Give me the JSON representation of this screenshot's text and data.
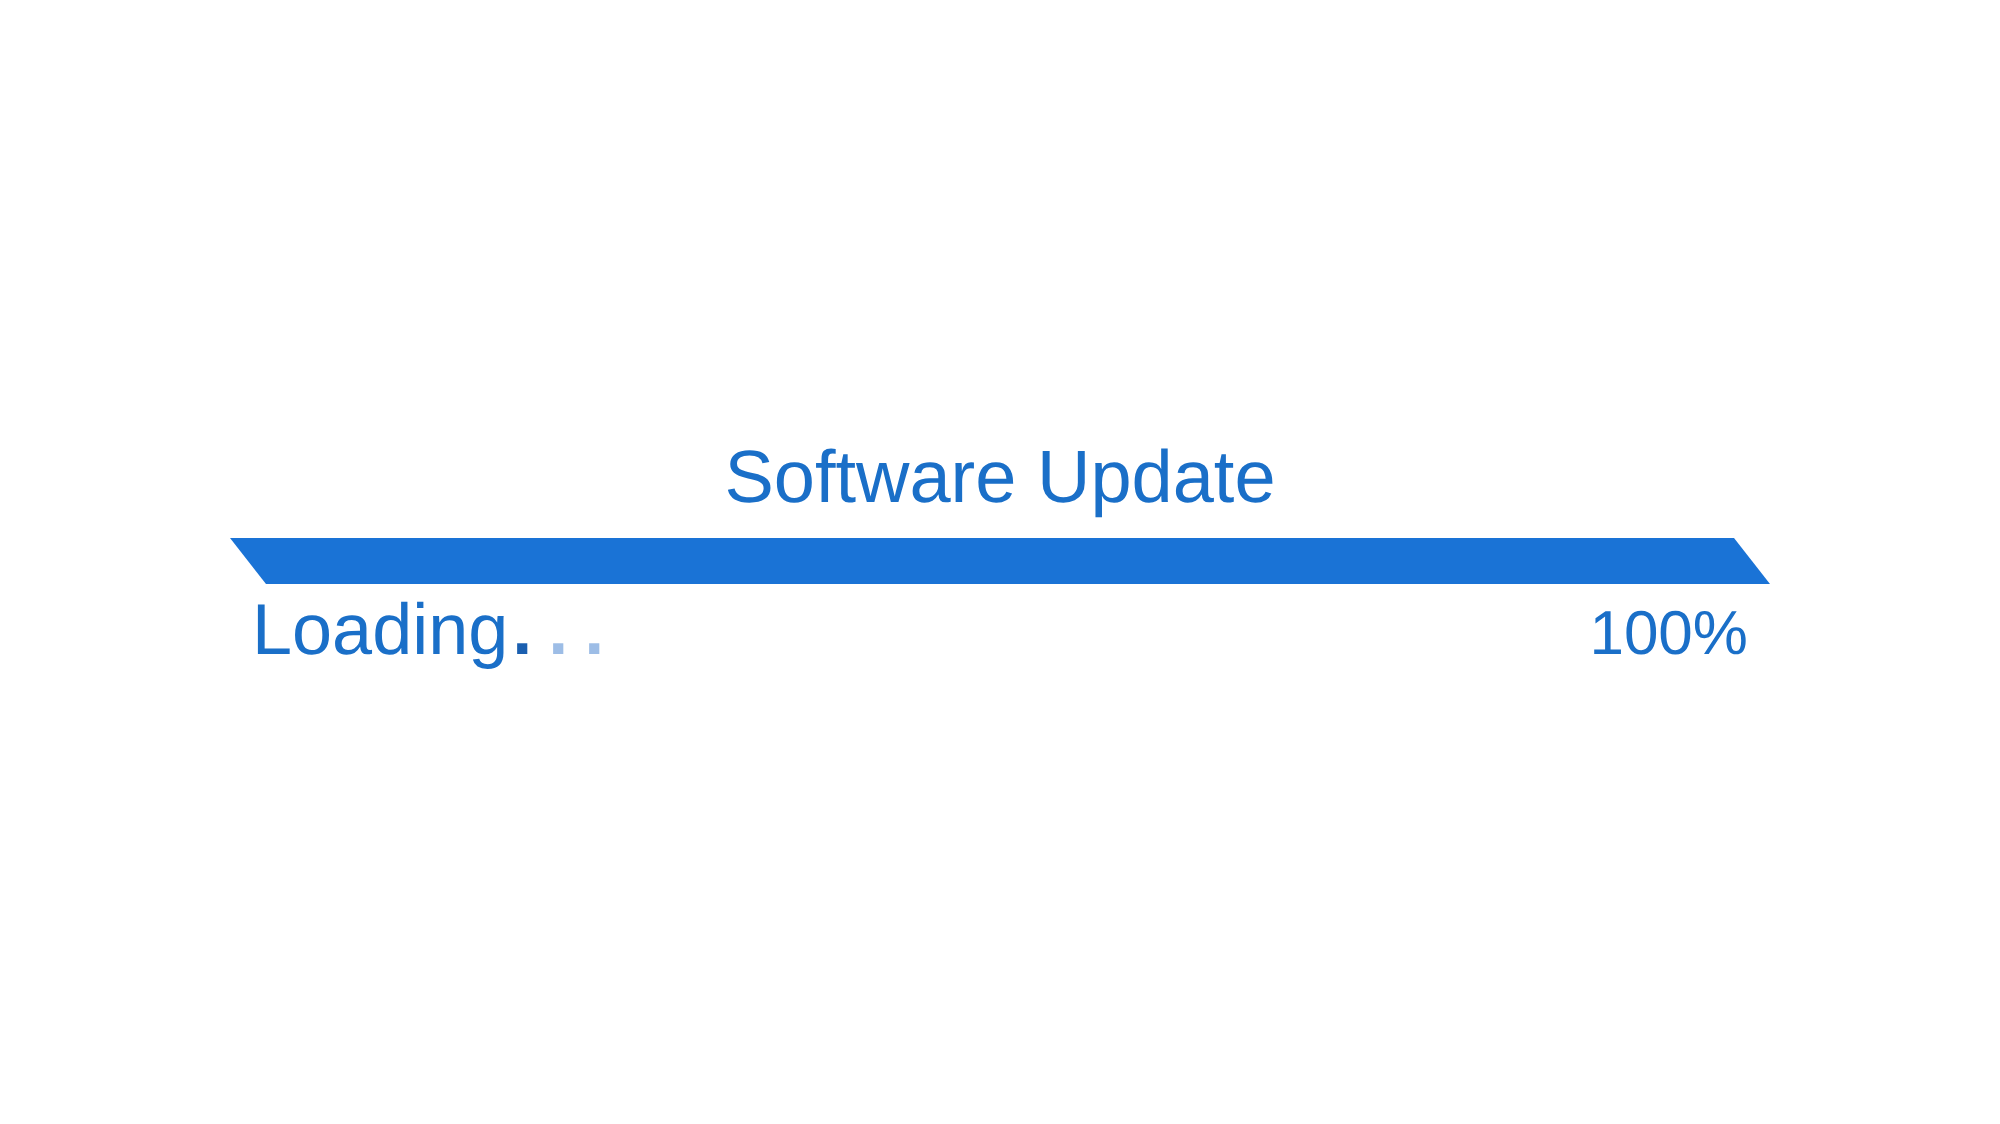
{
  "title": "Software Update",
  "status": {
    "label": "Loading",
    "dots": [
      {
        "char": ".",
        "lit": true
      },
      {
        "char": ".",
        "lit": false
      },
      {
        "char": ".",
        "lit": false
      }
    ],
    "percent": "100%"
  }
}
